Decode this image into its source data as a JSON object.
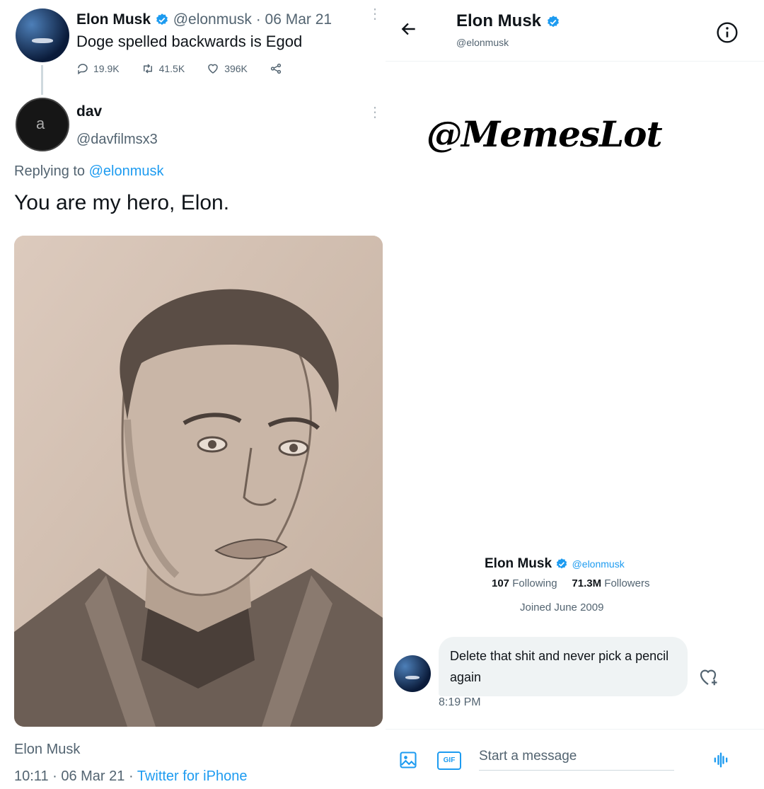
{
  "left": {
    "original_tweet": {
      "author_name": "Elon Musk",
      "handle_date": "@elonmusk · 06 Mar 21",
      "text": "Doge spelled backwards is Egod",
      "replies": "19.9K",
      "retweets": "41.5K",
      "likes": "396K"
    },
    "reply_tweet": {
      "author_name": "dav",
      "handle": "@davfilmsx3",
      "replying_prefix": "Replying to ",
      "replying_handle": "@elonmusk",
      "text": "You are my hero, Elon.",
      "attribution": "Elon Musk",
      "time_date": "10:11 · 06 Mar 21 · ",
      "source": "Twitter for iPhone"
    }
  },
  "right": {
    "header": {
      "name": "Elon Musk",
      "handle": "@elonmusk"
    },
    "watermark": "@MemesLot",
    "profile_card": {
      "name": "Elon Musk",
      "handle": "@elonmusk",
      "following_count": "107",
      "following_label": "Following",
      "followers_count": "71.3M",
      "followers_label": "Followers",
      "joined": "Joined June 2009"
    },
    "message": {
      "text": "Delete that shit and never pick a pencil again",
      "time": "8:19 PM"
    },
    "composer": {
      "placeholder": "Start a message",
      "gif_label": "GIF"
    }
  },
  "colors": {
    "accent": "#1d9bf0",
    "muted": "#536471"
  }
}
